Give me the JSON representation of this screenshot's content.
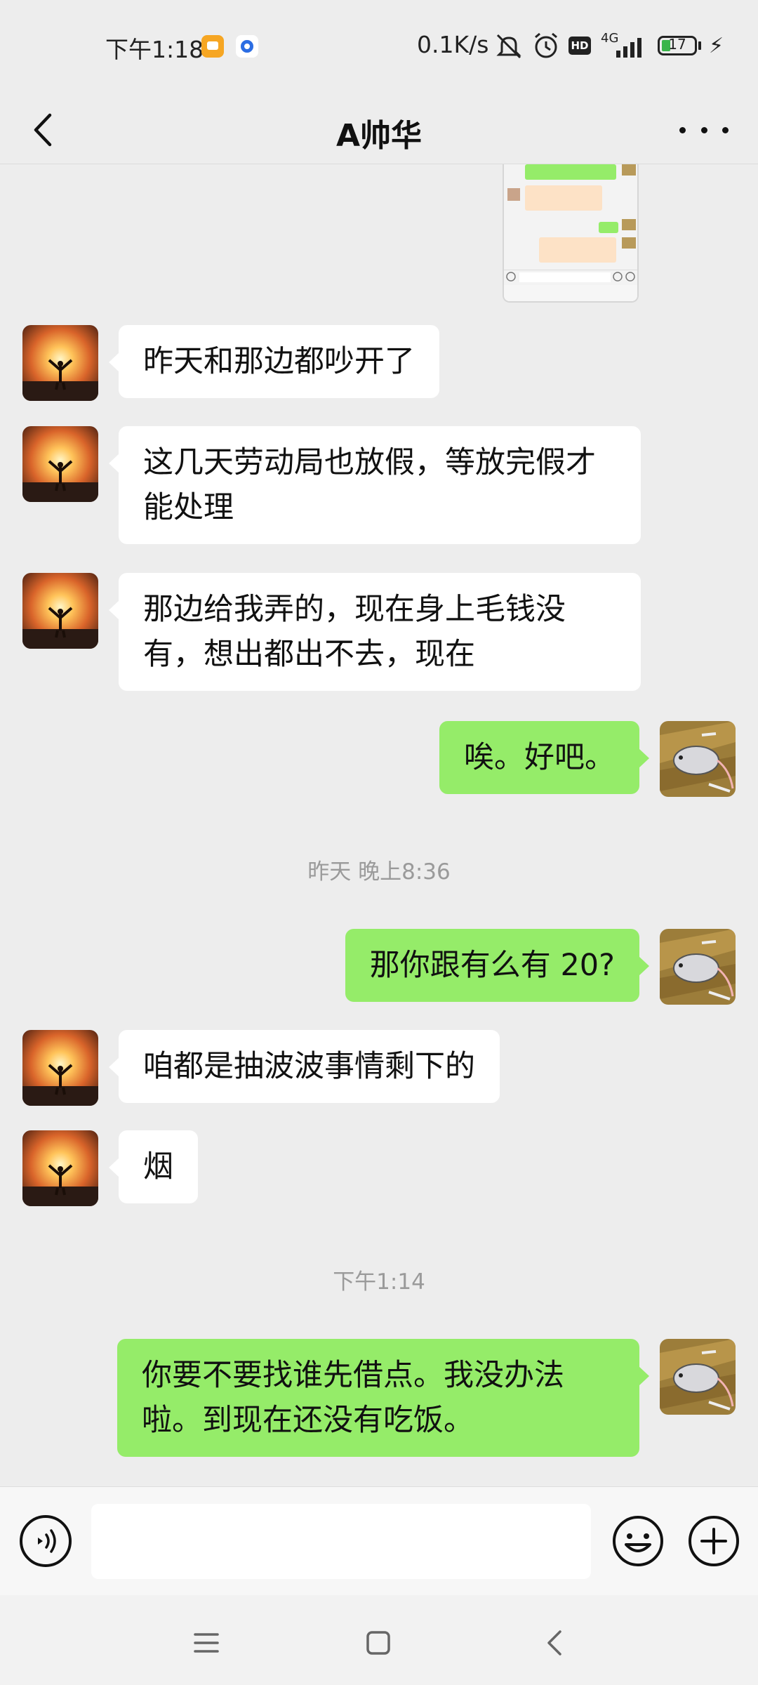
{
  "status_bar": {
    "time": "下午1:18",
    "net_speed": "0.1K/s",
    "network": "4G",
    "hd": "HD",
    "battery": "17"
  },
  "header": {
    "title": "A帅华"
  },
  "messages": [
    {
      "side": "in",
      "text": "昨天和那边都吵开了"
    },
    {
      "side": "in",
      "text": "这几天劳动局也放假，等放完假才能处理"
    },
    {
      "side": "in",
      "text": "那边给我弄的，现在身上毛钱没有，想出都出不去，现在"
    },
    {
      "side": "out",
      "text": "唉。好吧。"
    },
    {
      "side": "time",
      "text": "昨天 晚上8:36"
    },
    {
      "side": "out",
      "text": "那你跟有么有 20?"
    },
    {
      "side": "in",
      "text": "咱都是抽波波事情剩下的"
    },
    {
      "side": "in",
      "text": "烟"
    },
    {
      "side": "time",
      "text": "下午1:14"
    },
    {
      "side": "out",
      "text": "你要不要找谁先借点。我没办法啦。到现在还没有吃饭。"
    }
  ],
  "colors": {
    "background": "#ededed",
    "bubble_out": "#95ec69",
    "bubble_in": "#ffffff"
  },
  "icons": {
    "back": "chevron-left-icon",
    "more": "more-dots-icon",
    "voice": "voice-icon",
    "emoji": "emoji-icon",
    "plus": "plus-icon"
  }
}
